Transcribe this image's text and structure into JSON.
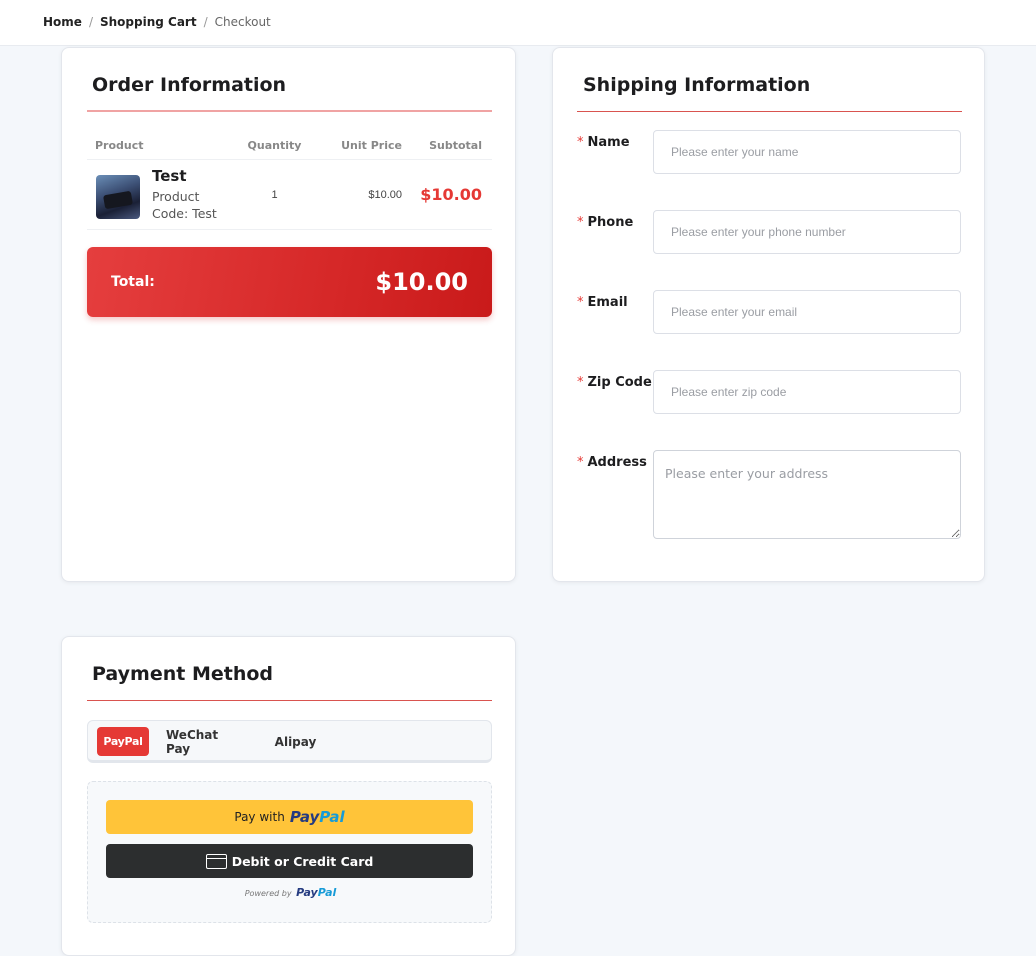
{
  "breadcrumb": {
    "home": "Home",
    "cart": "Shopping Cart",
    "current": "Checkout",
    "separator": "/"
  },
  "order": {
    "title": "Order Information",
    "columns": {
      "product": "Product",
      "quantity": "Quantity",
      "unit_price": "Unit Price",
      "subtotal": "Subtotal"
    },
    "items": [
      {
        "name": "Test",
        "code": "Product Code: Test",
        "quantity": "1",
        "unit_price": "$10.00",
        "subtotal": "$10.00"
      }
    ],
    "total_label": "Total:",
    "total_value": "$10.00"
  },
  "shipping": {
    "title": "Shipping Information",
    "required_mark": "*",
    "fields": {
      "name": {
        "label": "Name",
        "placeholder": "Please enter your name"
      },
      "phone": {
        "label": "Phone",
        "placeholder": "Please enter your phone number"
      },
      "email": {
        "label": "Email",
        "placeholder": "Please enter your email"
      },
      "zip": {
        "label": "Zip Code",
        "placeholder": "Please enter zip code"
      },
      "address": {
        "label": "Address",
        "placeholder": "Please enter your address"
      }
    }
  },
  "payment": {
    "title": "Payment Method",
    "tabs": [
      {
        "label": "PayPal",
        "active": true
      },
      {
        "label": "WeChat Pay",
        "active": false
      },
      {
        "label": "Alipay",
        "active": false
      }
    ],
    "paypal_button": {
      "prefix": "Pay with",
      "brand_a": "Pay",
      "brand_b": "Pal"
    },
    "card_button": "Debit or Credit Card",
    "powered_by": "Powered by",
    "powered_brand_a": "Pay",
    "powered_brand_b": "Pal"
  },
  "colors": {
    "accent_red": "#e53935",
    "paypal_yellow": "#ffc439",
    "paypal_dark_blue": "#253b80",
    "paypal_light_blue": "#179bd7",
    "card_button_bg": "#2c2e2f"
  }
}
